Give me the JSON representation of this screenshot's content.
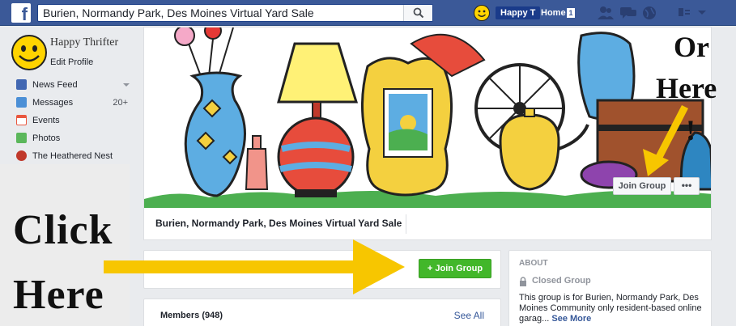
{
  "header": {
    "search_value": "Burien, Normandy Park, Des Moines Virtual Yard Sale",
    "user_name": "Happy T",
    "home_label": "Home",
    "home_count": "1"
  },
  "sidebar": {
    "profile_name": "Happy Thrifter",
    "edit_profile": "Edit Profile",
    "items": [
      {
        "label": "News Feed",
        "count": "",
        "icon": "news-feed-icon",
        "color": "#4267b2"
      },
      {
        "label": "Messages",
        "count": "20+",
        "icon": "messages-icon",
        "color": "#4b8fd6"
      },
      {
        "label": "Events",
        "count": "",
        "icon": "calendar-icon",
        "color": "#e9573f"
      },
      {
        "label": "Photos",
        "count": "",
        "icon": "photos-icon",
        "color": "#5bb75b"
      },
      {
        "label": "The Heathered Nest",
        "count": "",
        "icon": "nest-icon",
        "color": "#c0392b"
      }
    ]
  },
  "overlay": {
    "click": "Click",
    "here": "Here",
    "or": "Or",
    "here2": "Here",
    "excl": "!"
  },
  "group": {
    "title": "Burien, Normandy Park, Des Moines Virtual Yard Sale",
    "cover_join": "Join Group",
    "cover_more": "•••",
    "join_button": "+ Join Group",
    "members_label": "Members (948)",
    "see_all": "See All"
  },
  "about": {
    "heading": "ABOUT",
    "closed_label": "Closed Group",
    "description": "This group is for Burien, Normandy Park, Des Moines Community only resident-based online garag...",
    "see_more": "See More"
  },
  "colors": {
    "facebook_blue": "#3b5998",
    "join_green": "#42b72a",
    "arrow_yellow": "#f7c600"
  }
}
